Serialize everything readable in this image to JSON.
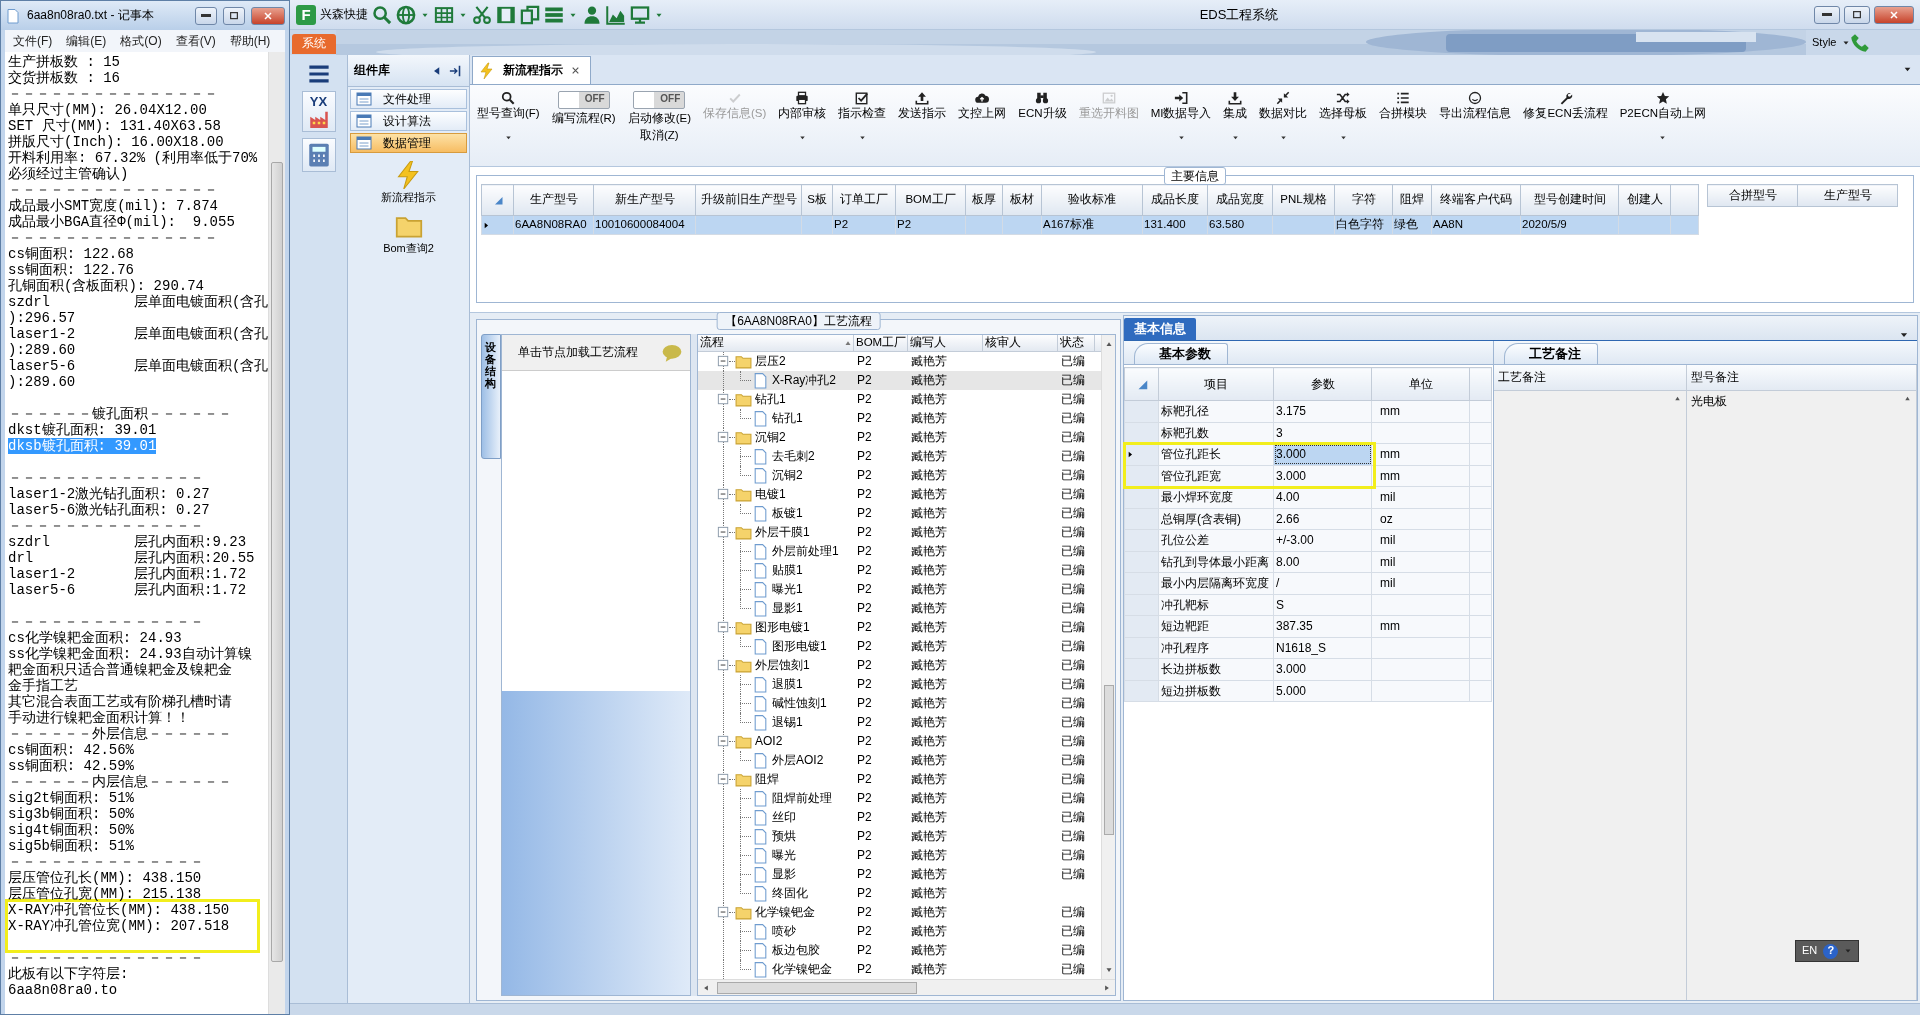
{
  "notepad": {
    "title": "6aa8n08ra0.txt - 记事本",
    "menu": [
      "文件(F)",
      "编辑(E)",
      "格式(O)",
      "查看(V)",
      "帮助(H)"
    ],
    "lines": [
      {
        "kind": "text",
        "text": "生产拼板数 : 15",
        "selected": false
      },
      {
        "kind": "text",
        "text": "交货拼板数 : 16",
        "selected": false
      },
      {
        "kind": "text",
        "text": "－－－－－－－－－－－－－－－",
        "selected": false
      },
      {
        "kind": "text",
        "text": "单只尺寸(MM): 26.04X12.00",
        "selected": false
      },
      {
        "kind": "text",
        "text": "SET 尺寸(MM): 131.40X63.58",
        "selected": false
      },
      {
        "kind": "text",
        "text": "拼版尺寸(Inch): 16.00X18.00",
        "selected": false
      },
      {
        "kind": "text",
        "text": "开料利用率: 67.32% (利用率低于70%",
        "selected": false
      },
      {
        "kind": "text",
        "text": "必须经过主管确认)",
        "selected": false
      },
      {
        "kind": "text",
        "text": "－－－－－－－－－－－－－－－",
        "selected": false
      },
      {
        "kind": "text",
        "text": "成品最小SMT宽度(mil): 7.874",
        "selected": false
      },
      {
        "kind": "text",
        "text": "成品最小BGA直径Φ(mil):  9.055",
        "selected": false
      },
      {
        "kind": "text",
        "text": "－－－－－－－－－－－－－－－",
        "selected": false
      },
      {
        "kind": "text",
        "text": "cs铜面积: 122.68",
        "selected": false
      },
      {
        "kind": "text",
        "text": "ss铜面积: 122.76",
        "selected": false
      },
      {
        "kind": "text",
        "text": "孔铜面积(含板面积): 290.74",
        "selected": false
      },
      {
        "kind": "text",
        "text": "szdrl          层单面电镀面积(含孔",
        "selected": false
      },
      {
        "kind": "text",
        "text": "):296.57",
        "selected": false
      },
      {
        "kind": "text",
        "text": "laser1-2       层单面电镀面积(含孔",
        "selected": false
      },
      {
        "kind": "text",
        "text": "):289.60",
        "selected": false
      },
      {
        "kind": "text",
        "text": "laser5-6       层单面电镀面积(含孔",
        "selected": false
      },
      {
        "kind": "text",
        "text": "):289.60",
        "selected": false
      },
      {
        "kind": "blank"
      },
      {
        "kind": "text",
        "text": "－－－－－－镀孔面积－－－－－－",
        "selected": false
      },
      {
        "kind": "text",
        "text": "dkst镀孔面积: 39.01",
        "selected": false
      },
      {
        "kind": "text",
        "text": "dksb镀孔面积: 39.01",
        "selected": true
      },
      {
        "kind": "blank"
      },
      {
        "kind": "text",
        "text": "－－－－－－－－－－－－－－",
        "selected": false
      },
      {
        "kind": "text",
        "text": "laser1-2激光钻孔面积: 0.27",
        "selected": false
      },
      {
        "kind": "text",
        "text": "laser5-6激光钻孔面积: 0.27",
        "selected": false
      },
      {
        "kind": "text",
        "text": "－－－－－－－－－－－－－－",
        "selected": false
      },
      {
        "kind": "text",
        "text": "szdrl          层孔内面积:9.23",
        "selected": false
      },
      {
        "kind": "text",
        "text": "drl            层孔内面积:20.55",
        "selected": false
      },
      {
        "kind": "text",
        "text": "laser1-2       层孔内面积:1.72",
        "selected": false
      },
      {
        "kind": "text",
        "text": "laser5-6       层孔内面积:1.72",
        "selected": false
      },
      {
        "kind": "blank"
      },
      {
        "kind": "text",
        "text": "－－－－－－－－－－－－－－",
        "selected": false
      },
      {
        "kind": "text",
        "text": "cs化学镍耙金面积: 24.93",
        "selected": false
      },
      {
        "kind": "text",
        "text": "ss化学镍耙金面积: 24.93自动计算镍",
        "selected": false
      },
      {
        "kind": "text",
        "text": "耙金面积只适合普通镍耙金及镍耙金",
        "selected": false
      },
      {
        "kind": "text",
        "text": "金手指工艺",
        "selected": false
      },
      {
        "kind": "text",
        "text": "其它混合表面工艺或有阶梯孔槽时请",
        "selected": false
      },
      {
        "kind": "text",
        "text": "手动进行镍耙金面积计算！！",
        "selected": false
      },
      {
        "kind": "text",
        "text": "－－－－－－外层信息－－－－－－",
        "selected": false
      },
      {
        "kind": "text",
        "text": "cs铜面积: 42.56%",
        "selected": false
      },
      {
        "kind": "text",
        "text": "ss铜面积: 42.59%",
        "selected": false
      },
      {
        "kind": "text",
        "text": "－－－－－－内层信息－－－－－－",
        "selected": false
      },
      {
        "kind": "text",
        "text": "sig2t铜面积: 51%",
        "selected": false
      },
      {
        "kind": "text",
        "text": "sig3b铜面积: 50%",
        "selected": false
      },
      {
        "kind": "text",
        "text": "sig4t铜面积: 50%",
        "selected": false
      },
      {
        "kind": "text",
        "text": "sig5b铜面积: 51%",
        "selected": false
      },
      {
        "kind": "text",
        "text": "－－－－－－－－－－－－－－",
        "selected": false
      },
      {
        "kind": "text",
        "text": "层压管位孔长(MM): 438.150",
        "selected": false
      },
      {
        "kind": "text",
        "text": "层压管位孔宽(MM): 215.138",
        "selected": false
      },
      {
        "kind": "boxed",
        "lines": [
          {
            "kind": "text",
            "text": "X-RAY冲孔管位长(MM): 438.150",
            "selected": false
          },
          {
            "kind": "text",
            "text": "X-RAY冲孔管位宽(MM): 207.518",
            "selected": false
          },
          {
            "kind": "blank"
          }
        ]
      },
      {
        "kind": "text",
        "text": "－－－－－－－－－－－－－－",
        "selected": false
      },
      {
        "kind": "text",
        "text": "此板有以下字符层:",
        "selected": false
      },
      {
        "kind": "text",
        "text": "6aa8n08ra0.to",
        "selected": false
      }
    ]
  },
  "app": {
    "logo": "F",
    "brand": "兴森快捷",
    "title": "EDS工程系统",
    "system_tab": "系统",
    "style_menu": "Style",
    "nav_badge": "YX",
    "library": {
      "title": "组件库",
      "items": [
        {
          "label": "文件处理",
          "selected": false
        },
        {
          "label": "设计算法",
          "selected": false
        },
        {
          "label": "数据管理",
          "selected": true
        }
      ],
      "tools": [
        {
          "label": "新流程指示"
        },
        {
          "label": "Bom查询2"
        }
      ]
    },
    "tabs": [
      {
        "label": "新流程指示",
        "selected": true
      }
    ],
    "toolbar": [
      {
        "kind": "button",
        "label": "型号查询(F)",
        "disabled": false,
        "has_menu": true
      },
      {
        "kind": "toggle",
        "label": "编写流程(R)",
        "switch": "OFF",
        "on": false
      },
      {
        "kind": "toggle",
        "label": "启动修改(E)",
        "sublabel": "取消(Z)",
        "switch": "OFF",
        "on": false
      },
      {
        "kind": "button",
        "label": "保存信息(S)",
        "disabled": true,
        "has_menu": false
      },
      {
        "kind": "button",
        "label": "内部审核",
        "disabled": false,
        "has_menu": true
      },
      {
        "kind": "button",
        "label": "指示检查",
        "disabled": false,
        "has_menu": true
      },
      {
        "kind": "button",
        "label": "发送指示",
        "disabled": false,
        "has_menu": false
      },
      {
        "kind": "button",
        "label": "文控上网",
        "disabled": false,
        "has_menu": false
      },
      {
        "kind": "button",
        "label": "ECN升级",
        "disabled": false,
        "has_menu": false
      },
      {
        "kind": "button",
        "label": "重选开料图",
        "disabled": true,
        "has_menu": false
      },
      {
        "kind": "button",
        "label": "MI数据导入",
        "disabled": false,
        "has_menu": true
      },
      {
        "kind": "button",
        "label": "集成",
        "disabled": false,
        "has_menu": true
      },
      {
        "kind": "button",
        "label": "数据对比",
        "disabled": false,
        "has_menu": true
      },
      {
        "kind": "button",
        "label": "选择母板",
        "disabled": false,
        "has_menu": true
      },
      {
        "kind": "button",
        "label": "合拼模块",
        "disabled": false,
        "has_menu": false
      },
      {
        "kind": "button",
        "label": "导出流程信息",
        "disabled": false,
        "has_menu": false
      },
      {
        "kind": "button",
        "label": "修复ECN丢流程",
        "disabled": false,
        "has_menu": false
      },
      {
        "kind": "button",
        "label": "P2ECN自动上网",
        "disabled": false,
        "has_menu": true
      }
    ],
    "main_info": {
      "title": "主要信息",
      "columns": [
        "生产型号",
        "新生产型号",
        "升级前旧生产型号",
        "S板",
        "订单工厂",
        "BOM工厂",
        "板厚",
        "板材",
        "验收标准",
        "成品长度",
        "成品宽度",
        "PNL规格",
        "字符",
        "阻焊",
        "终端客户代码",
        "型号创建时间",
        "创建人"
      ],
      "rows": [
        {
          "selected": true,
          "cells": [
            "6AA8N08RA0",
            "10010600084004",
            null,
            null,
            "P2",
            "P2",
            null,
            null,
            "A167标准",
            "131.400",
            "63.580",
            null,
            "白色字符",
            "绿色",
            "AA8N",
            "2020/5/9",
            null
          ]
        }
      ],
      "side_columns": [
        "合拼型号",
        "生产型号"
      ]
    },
    "process": {
      "title": "【6AA8N08RA0】工艺流程",
      "side_tab": "设备结构",
      "hint": "单击节点加载工艺流程",
      "columns": [
        "流程",
        "BOM工厂",
        "编写人",
        "核审人",
        "状态"
      ],
      "tree": [
        {
          "label": "层压2",
          "bom": "P2",
          "writer": "臧艳芳",
          "status": "已编",
          "expanded": true,
          "selected": false,
          "children": [
            {
              "label": "X-Ray冲孔2",
              "bom": "P2",
              "writer": "臧艳芳",
              "status": "已编",
              "selected": true
            }
          ]
        },
        {
          "label": "钻孔1",
          "bom": "P2",
          "writer": "臧艳芳",
          "status": "已编",
          "expanded": true,
          "selected": false,
          "children": [
            {
              "label": "钻孔1",
              "bom": "P2",
              "writer": "臧艳芳",
              "status": "已编",
              "selected": false
            }
          ]
        },
        {
          "label": "沉铜2",
          "bom": "P2",
          "writer": "臧艳芳",
          "status": "已编",
          "expanded": true,
          "selected": false,
          "children": [
            {
              "label": "去毛刺2",
              "bom": "P2",
              "writer": "臧艳芳",
              "status": "已编",
              "selected": false
            },
            {
              "label": "沉铜2",
              "bom": "P2",
              "writer": "臧艳芳",
              "status": "已编",
              "selected": false
            }
          ]
        },
        {
          "label": "电镀1",
          "bom": "P2",
          "writer": "臧艳芳",
          "status": "已编",
          "expanded": true,
          "selected": false,
          "children": [
            {
              "label": "板镀1",
              "bom": "P2",
              "writer": "臧艳芳",
              "status": "已编",
              "selected": false
            }
          ]
        },
        {
          "label": "外层干膜1",
          "bom": "P2",
          "writer": "臧艳芳",
          "status": "已编",
          "expanded": true,
          "selected": false,
          "children": [
            {
              "label": "外层前处理1",
              "bom": "P2",
              "writer": "臧艳芳",
              "status": "已编",
              "selected": false
            },
            {
              "label": "贴膜1",
              "bom": "P2",
              "writer": "臧艳芳",
              "status": "已编",
              "selected": false
            },
            {
              "label": "曝光1",
              "bom": "P2",
              "writer": "臧艳芳",
              "status": "已编",
              "selected": false
            },
            {
              "label": "显影1",
              "bom": "P2",
              "writer": "臧艳芳",
              "status": "已编",
              "selected": false
            }
          ]
        },
        {
          "label": "图形电镀1",
          "bom": "P2",
          "writer": "臧艳芳",
          "status": "已编",
          "expanded": true,
          "selected": false,
          "children": [
            {
              "label": "图形电镀1",
              "bom": "P2",
              "writer": "臧艳芳",
              "status": "已编",
              "selected": false
            }
          ]
        },
        {
          "label": "外层蚀刻1",
          "bom": "P2",
          "writer": "臧艳芳",
          "status": "已编",
          "expanded": true,
          "selected": false,
          "children": [
            {
              "label": "退膜1",
              "bom": "P2",
              "writer": "臧艳芳",
              "status": "已编",
              "selected": false
            },
            {
              "label": "碱性蚀刻1",
              "bom": "P2",
              "writer": "臧艳芳",
              "status": "已编",
              "selected": false
            },
            {
              "label": "退锡1",
              "bom": "P2",
              "writer": "臧艳芳",
              "status": "已编",
              "selected": false
            }
          ]
        },
        {
          "label": "AOI2",
          "bom": "P2",
          "writer": "臧艳芳",
          "status": "已编",
          "expanded": true,
          "selected": false,
          "children": [
            {
              "label": "外层AOI2",
              "bom": "P2",
              "writer": "臧艳芳",
              "status": "已编",
              "selected": false
            }
          ]
        },
        {
          "label": "阻焊",
          "bom": "P2",
          "writer": "臧艳芳",
          "status": "已编",
          "expanded": true,
          "selected": false,
          "children": [
            {
              "label": "阻焊前处理",
              "bom": "P2",
              "writer": "臧艳芳",
              "status": "已编",
              "selected": false
            },
            {
              "label": "丝印",
              "bom": "P2",
              "writer": "臧艳芳",
              "status": "已编",
              "selected": false
            },
            {
              "label": "预烘",
              "bom": "P2",
              "writer": "臧艳芳",
              "status": "已编",
              "selected": false
            },
            {
              "label": "曝光",
              "bom": "P2",
              "writer": "臧艳芳",
              "status": "已编",
              "selected": false
            },
            {
              "label": "显影",
              "bom": "P2",
              "writer": "臧艳芳",
              "status": "已编",
              "selected": false
            },
            {
              "label": "终固化",
              "bom": "P2",
              "writer": "臧艳芳",
              "selected": false
            }
          ]
        },
        {
          "label": "化学镍钯金",
          "bom": "P2",
          "writer": "臧艳芳",
          "status": "已编",
          "expanded": true,
          "selected": false,
          "children": [
            {
              "label": "喷砂",
              "bom": "P2",
              "writer": "臧艳芳",
              "status": "已编",
              "selected": false
            },
            {
              "label": "板边包胶",
              "bom": "P2",
              "writer": "臧艳芳",
              "status": "已编",
              "selected": false
            },
            {
              "label": "化学镍钯金",
              "bom": "P2",
              "writer": "臧艳芳",
              "status": "已编",
              "selected": false
            }
          ]
        }
      ]
    },
    "basic_info": {
      "tab": "基本信息",
      "params_tab": "基本参数",
      "columns": [
        "项目",
        "参数",
        "单位"
      ],
      "rows": [
        {
          "item": "标靶孔径",
          "value": "3.175",
          "unit": "mm",
          "selected": false,
          "boxed": false
        },
        {
          "item": "标靶孔数",
          "value": "3",
          "selected": false,
          "boxed": false
        },
        {
          "item": "管位孔距长",
          "value": "3.000",
          "unit": "mm",
          "selected": true,
          "boxed": true
        },
        {
          "item": "管位孔距宽",
          "value": "3.000",
          "unit": "mm",
          "selected": false,
          "boxed": true
        },
        {
          "item": "最小焊环宽度",
          "value": "4.00",
          "unit": "mil",
          "selected": false,
          "boxed": false
        },
        {
          "item": "总铜厚(含表铜)",
          "value": "2.66",
          "unit": "oz",
          "selected": false,
          "boxed": false
        },
        {
          "item": "孔位公差",
          "value": "+/-3.00",
          "unit": "mil",
          "selected": false,
          "boxed": false
        },
        {
          "item": "钻孔到导体最小距离",
          "value": "8.00",
          "unit": "mil",
          "selected": false,
          "boxed": false
        },
        {
          "item": "最小内层隔离环宽度",
          "value": "/",
          "unit": "mil",
          "selected": false,
          "boxed": false
        },
        {
          "item": "冲孔靶标",
          "value": "S",
          "selected": false,
          "boxed": false
        },
        {
          "item": "短边靶距",
          "value": "387.35",
          "unit": "mm",
          "selected": false,
          "boxed": false
        },
        {
          "item": "冲孔程序",
          "value": "N1618_S",
          "selected": false,
          "boxed": false
        },
        {
          "item": "长边拼板数",
          "value": "3.000",
          "selected": false,
          "boxed": false
        },
        {
          "item": "短边拼板数",
          "value": "5.000",
          "selected": false,
          "boxed": false
        }
      ],
      "notes_tab": "工艺备注",
      "notes_columns": [
        "工艺备注",
        "型号备注"
      ],
      "model_note": "光电板"
    },
    "language_bar": {
      "label": "EN",
      "help": "?"
    }
  }
}
